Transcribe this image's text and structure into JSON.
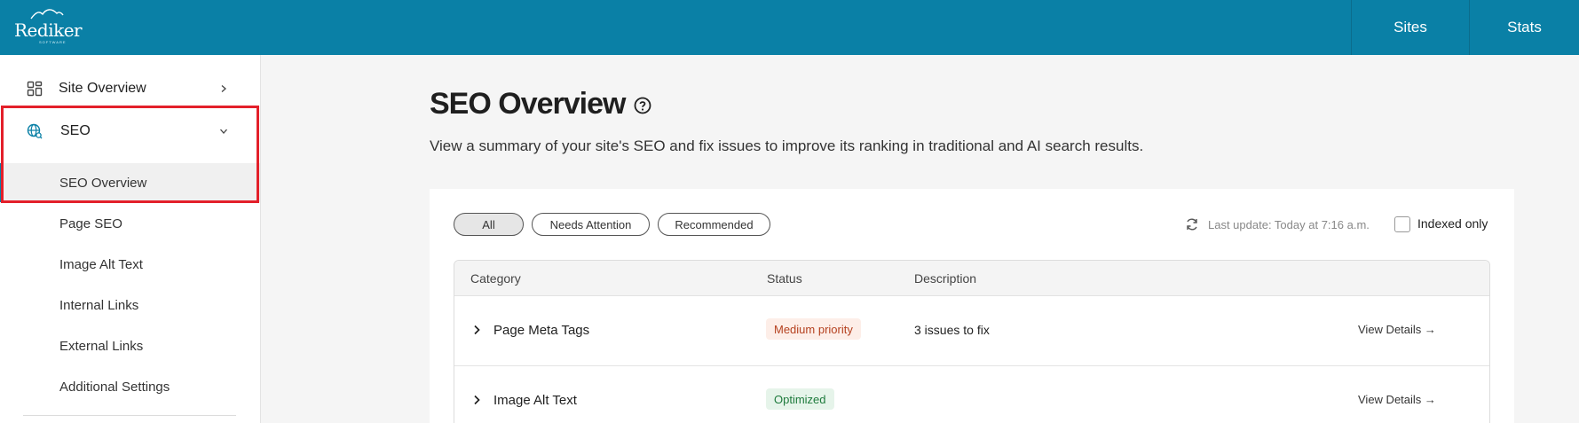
{
  "app": {
    "logo_text": "Rediker",
    "logo_subtext": "SOFTWARE",
    "nav": [
      "Sites",
      "Stats"
    ],
    "accent_color": "#0a80a6"
  },
  "sidebar": {
    "site_overview": {
      "label": "Site Overview",
      "icon": "grid-icon"
    },
    "seo": {
      "label": "SEO",
      "icon": "globe-search-icon",
      "expanded": true
    },
    "sub_items": [
      "SEO Overview",
      "Page SEO",
      "Image Alt Text",
      "Internal Links",
      "External Links",
      "Additional Settings"
    ],
    "active_sub_item": "SEO Overview"
  },
  "main": {
    "title": "SEO Overview",
    "description": "View a summary of your site's SEO and fix issues to improve its ranking in traditional and AI search results.",
    "filters": [
      "All",
      "Needs Attention",
      "Recommended"
    ],
    "selected_filter": "All",
    "last_update": "Last update: Today at 7:16 a.m.",
    "indexed_only_label": "Indexed only",
    "indexed_only_checked": false,
    "table": {
      "headers": [
        "Category",
        "Status",
        "Description"
      ],
      "rows": [
        {
          "category": "Page Meta Tags",
          "status": "Medium priority",
          "description": "3 issues to fix",
          "action": "View Details →"
        },
        {
          "category": "Image Alt Text",
          "status": "Optimized",
          "description": "",
          "action": "View Details →"
        }
      ]
    }
  }
}
